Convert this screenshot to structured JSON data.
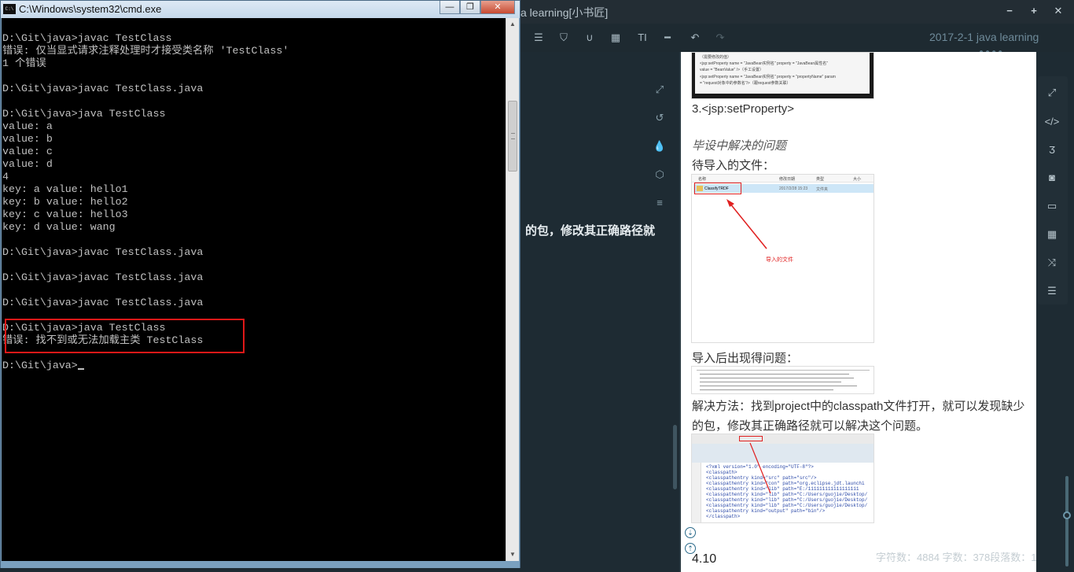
{
  "editor": {
    "window_title": "a learning[小书匠]",
    "window_controls": {
      "minimize": "−",
      "maximize": "+",
      "close": "✕"
    },
    "doc_title": "2017-2-1 java learning",
    "toolbar_icons": [
      "list-icon",
      "html5-icon",
      "magnet-icon",
      "table-icon",
      "title-icon",
      "hr-icon",
      "undo-icon",
      "redo-icon"
    ],
    "editor_text": "的包，修改其正确路径就",
    "side_icons": [
      "expand-icon",
      "history-icon",
      "ink-drop-icon",
      "cube-icon",
      "menu-icon"
    ]
  },
  "preview": {
    "img1_lines": [
      "（需要修改的值）",
      "<jsp:setProperty name = \"JavaBean实例名\" property = \"JavaBean属性名\"",
      "value = \"BeanValue\" />（手工设置）",
      "<jsp:setProperty name = \"JavaBean实例名\" property = \"propertyName\" param",
      "= \"request对象中的参数名\"/>（跟request参数关联）"
    ],
    "heading1": "3.<jsp:setProperty>",
    "heading2": "毕设中解决的问题",
    "text1": "待导入的文件：",
    "img2": {
      "columns": [
        "名称",
        "修改日期",
        "类型",
        "大小"
      ],
      "row": [
        "ClassifyTRDF",
        "2017/2/28 15:23",
        "文件夹"
      ],
      "annotation": "导入的文件"
    },
    "text2": "导入后出现得问题：",
    "text3_line1": "解决方法：找到project中的classpath文件打开，就可以发现缺少",
    "text3_line2": "的包，修改其正确路径就可以解决这个问题。",
    "img4_code": [
      "<?xml version=\"1.0\" encoding=\"UTF-8\"?>",
      "<classpath>",
      "  <classpathentry kind=\"src\" path=\"src\"/>",
      "  <classpathentry kind=\"con\" path=\"org.eclipse.jdt.launchi",
      "  <classpathentry kind=\"lib\" path=\"E:/111111111111111111",
      "  <classpathentry kind=\"lib\" path=\"C:/Users/guojie/Desktop/",
      "  <classpathentry kind=\"lib\" path=\"C:/Users/guojie/Desktop/",
      "  <classpathentry kind=\"lib\" path=\"C:/Users/guojie/Desktop/",
      "  <classpathentry kind=\"output\" path=\"bin\"/>",
      "</classpath>"
    ],
    "last_line": "4.10",
    "stats": "字符数：4884 字数：378段落数：171"
  },
  "right_sidebar_icons": [
    "expand-icon",
    "code-icon",
    "css3-icon",
    "camera-icon",
    "desktop-icon",
    "grid-icon",
    "shuffle-icon",
    "list-icon"
  ],
  "cmd": {
    "title": "C:\\Windows\\system32\\cmd.exe",
    "icon_label": "C:\\",
    "buttons": {
      "minimize": "—",
      "maximize": "❐",
      "close": "✕"
    },
    "lines": [
      "D:\\Git\\java>javac TestClass",
      "错误: 仅当显式请求注释处理时才接受类名称 'TestClass'",
      "1 个错误",
      "",
      "D:\\Git\\java>javac TestClass.java",
      "",
      "D:\\Git\\java>java TestClass",
      "value: a",
      "value: b",
      "value: c",
      "value: d",
      "4",
      "key: a value: hello1",
      "key: b value: hello2",
      "key: c value: hello3",
      "key: d value: wang",
      "",
      "D:\\Git\\java>javac TestClass.java",
      "",
      "D:\\Git\\java>javac TestClass.java",
      "",
      "D:\\Git\\java>javac TestClass.java",
      "",
      "D:\\Git\\java>java TestClass",
      "错误: 找不到或无法加载主类 TestClass",
      "",
      "D:\\Git\\java>"
    ]
  }
}
